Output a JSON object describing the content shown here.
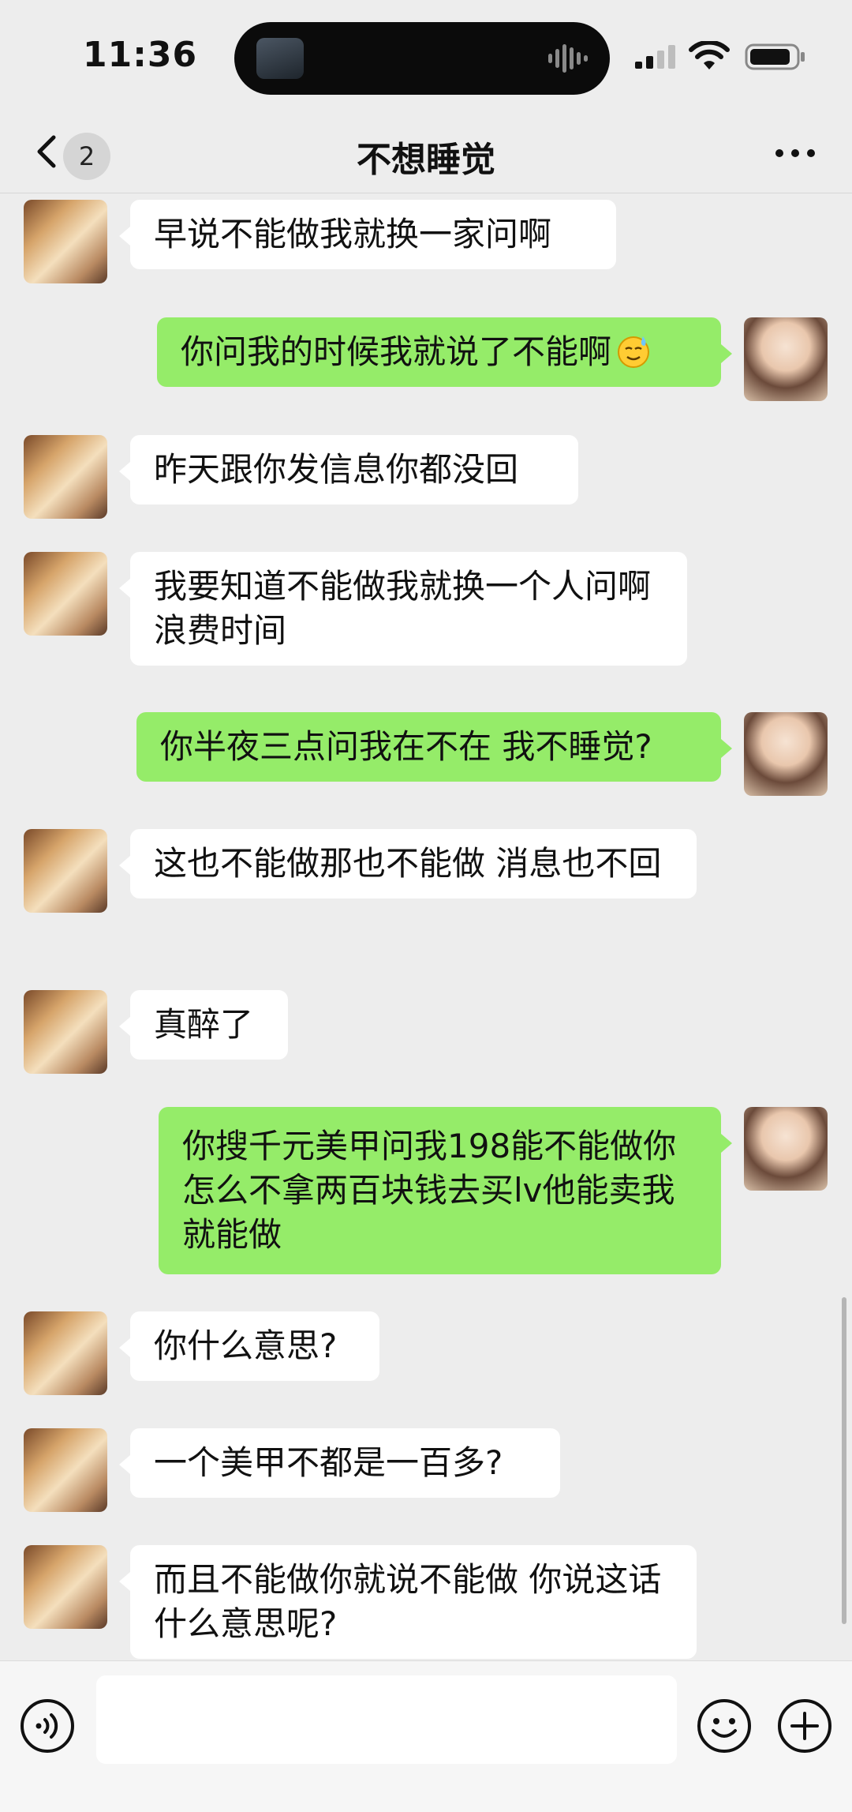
{
  "status_bar": {
    "time": "11:36",
    "island_icons": [
      "media-thumbnail-icon",
      "audio-waveform-icon"
    ],
    "right_icons": [
      "cellular-signal-icon",
      "wifi-icon",
      "battery-icon"
    ]
  },
  "header": {
    "back_icon": "chevron-left-icon",
    "unread_count": "2",
    "title": "不想睡觉",
    "more_icon": "more-dots-icon"
  },
  "messages": [
    {
      "from": "other",
      "text": "早说不能做我就换一家问啊"
    },
    {
      "from": "me",
      "text": "你问我的时候我就说了不能啊",
      "emoji": "sweat-smile-emoji"
    },
    {
      "from": "other",
      "text": "昨天跟你发信息你都没回"
    },
    {
      "from": "other",
      "text": "我要知道不能做我就换一个人问啊 浪费时间"
    },
    {
      "from": "me",
      "text": "你半夜三点问我在不在 我不睡觉?"
    },
    {
      "from": "other",
      "text": "这也不能做那也不能做 消息也不回"
    },
    {
      "from": "other",
      "text": "真醉了"
    },
    {
      "from": "me",
      "text": "你搜千元美甲问我198能不能做你怎么不拿两百块钱去买lv他能卖我就能做"
    },
    {
      "from": "other",
      "text": "你什么意思?"
    },
    {
      "from": "other",
      "text": "一个美甲不都是一百多?"
    },
    {
      "from": "other",
      "text": "而且不能做你就说不能做 你说这话什么意思呢?"
    }
  ],
  "input_bar": {
    "voice_icon": "voice-input-icon",
    "input_value": "",
    "emoji_icon": "emoji-face-icon",
    "plus_icon": "plus-circle-icon"
  },
  "colors": {
    "background": "#ededed",
    "bubble_me": "#95ec69",
    "bubble_other": "#ffffff",
    "input_bar": "#f6f6f6"
  }
}
